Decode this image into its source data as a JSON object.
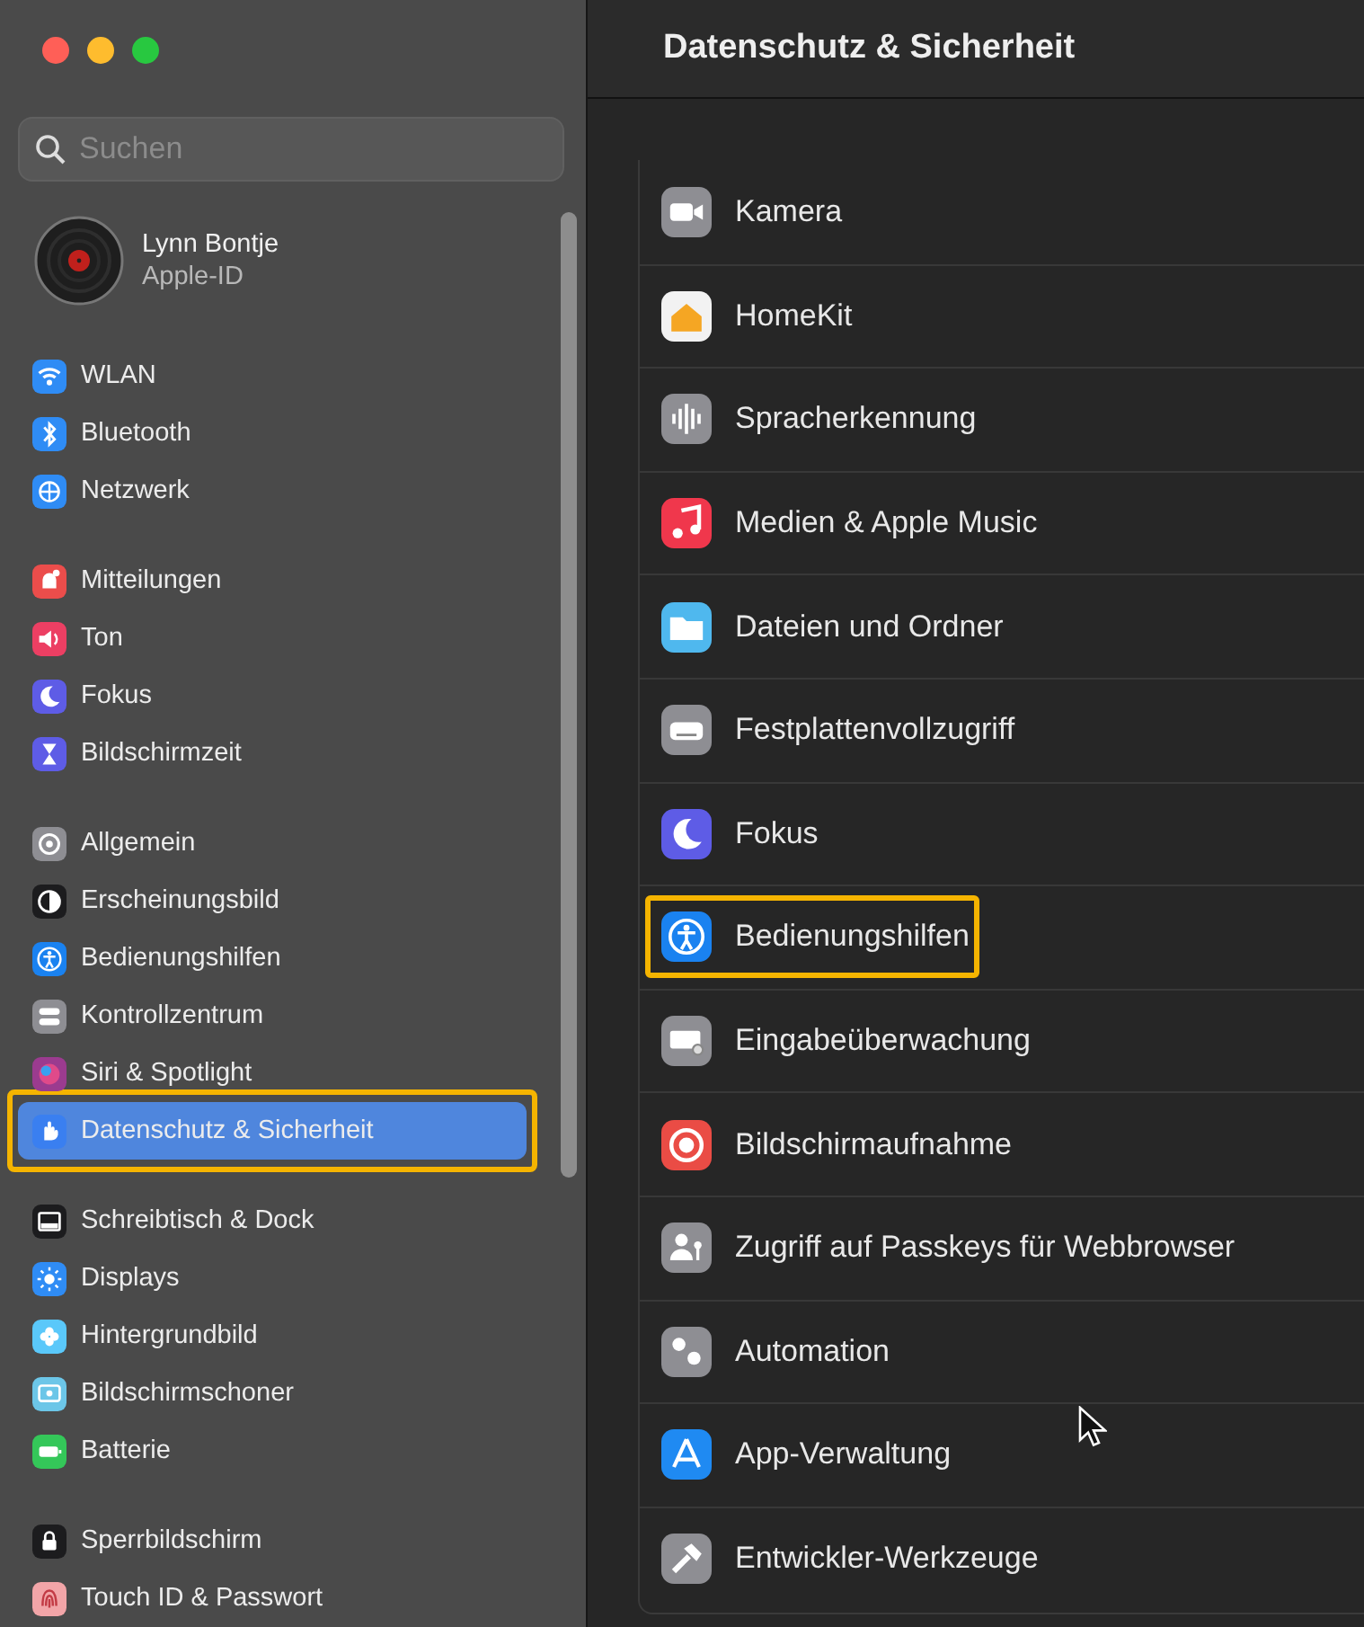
{
  "sidebar": {
    "search": {
      "placeholder": "Suchen"
    },
    "account": {
      "name": "Lynn Bontje",
      "subtitle": "Apple-ID"
    },
    "groups": [
      {
        "items": [
          {
            "label": "WLAN",
            "color": "#2f8cf5",
            "selected": false,
            "highlighted": false
          },
          {
            "label": "Bluetooth",
            "color": "#2f8cf5",
            "selected": false,
            "highlighted": false
          },
          {
            "label": "Netzwerk",
            "color": "#2f8cf5",
            "selected": false,
            "highlighted": false
          }
        ]
      },
      {
        "items": [
          {
            "label": "Mitteilungen",
            "color": "#eb4d4b",
            "selected": false,
            "highlighted": false
          },
          {
            "label": "Ton",
            "color": "#ec3f63",
            "selected": false,
            "highlighted": false
          },
          {
            "label": "Fokus",
            "color": "#5e5ce6",
            "selected": false,
            "highlighted": false
          },
          {
            "label": "Bildschirmzeit",
            "color": "#5e5ce6",
            "selected": false,
            "highlighted": false
          }
        ]
      },
      {
        "items": [
          {
            "label": "Allgemein",
            "color": "#8e8e93",
            "selected": false,
            "highlighted": false
          },
          {
            "label": "Erscheinungsbild",
            "color": "#1c1c1e",
            "selected": false,
            "highlighted": false
          },
          {
            "label": "Bedienungshilfen",
            "color": "#1a82f0",
            "selected": false,
            "highlighted": false
          },
          {
            "label": "Kontrollzentrum",
            "color": "#8e8e93",
            "selected": false,
            "highlighted": false
          },
          {
            "label": "Siri & Spotlight",
            "color": "#9b3b8f",
            "selected": false,
            "highlighted": false
          },
          {
            "label": "Datenschutz & Sicherheit",
            "color": "#3a7ff0",
            "selected": true,
            "highlighted": true
          }
        ]
      },
      {
        "items": [
          {
            "label": "Schreibtisch & Dock",
            "color": "#1c1c1e",
            "selected": false,
            "highlighted": false
          },
          {
            "label": "Displays",
            "color": "#2f8cf5",
            "selected": false,
            "highlighted": false
          },
          {
            "label": "Hintergrundbild",
            "color": "#5ac8fa",
            "selected": false,
            "highlighted": false
          },
          {
            "label": "Bildschirmschoner",
            "color": "#6cc6e8",
            "selected": false,
            "highlighted": false
          },
          {
            "label": "Batterie",
            "color": "#34c759",
            "selected": false,
            "highlighted": false
          }
        ]
      },
      {
        "items": [
          {
            "label": "Sperrbildschirm",
            "color": "#1c1c1e",
            "selected": false,
            "highlighted": false
          },
          {
            "label": "Touch ID & Passwort",
            "color": "#f2a5a8",
            "selected": false,
            "highlighted": false
          }
        ]
      }
    ]
  },
  "content": {
    "title": "Datenschutz & Sicherheit",
    "rows": [
      {
        "label": "Kamera",
        "color": "#8e8e93",
        "highlighted": false
      },
      {
        "label": "HomeKit",
        "color": "#f2f2f2",
        "highlighted": false
      },
      {
        "label": "Spracherkennung",
        "color": "#8e8e93",
        "highlighted": false
      },
      {
        "label": "Medien & Apple Music",
        "color": "#f0374c",
        "highlighted": false
      },
      {
        "label": "Dateien und Ordner",
        "color": "#4fb8ee",
        "highlighted": false
      },
      {
        "label": "Festplattenvollzugriff",
        "color": "#8e8e93",
        "highlighted": false
      },
      {
        "label": "Fokus",
        "color": "#5e5ce6",
        "highlighted": false
      },
      {
        "label": "Bedienungshilfen",
        "color": "#1a82f0",
        "highlighted": true
      },
      {
        "label": "Eingabeüberwachung",
        "color": "#8e8e93",
        "highlighted": false
      },
      {
        "label": "Bildschirmaufnahme",
        "color": "#ea4c45",
        "highlighted": false
      },
      {
        "label": "Zugriff auf Passkeys für Webbrowser",
        "color": "#8e8e93",
        "highlighted": false
      },
      {
        "label": "Automation",
        "color": "#8e8e93",
        "highlighted": false
      },
      {
        "label": "App-Verwaltung",
        "color": "#1f8af2",
        "highlighted": false
      },
      {
        "label": "Entwickler-Werkzeuge",
        "color": "#8e8e93",
        "highlighted": false
      }
    ]
  }
}
